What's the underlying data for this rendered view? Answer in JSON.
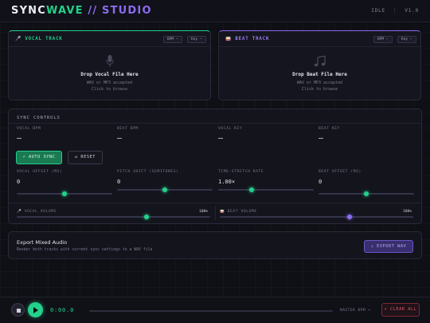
{
  "header": {
    "logo_part1": "SYNC",
    "logo_part2": "WAVE",
    "logo_part3": " // STUDIO",
    "status": "IDLE",
    "version": "V1.0"
  },
  "tracks": {
    "vocal": {
      "icon": "microphone-icon",
      "title": "VOCAL TRACK",
      "bpm_pill": "BPM —",
      "key_pill": "Key —",
      "drop_title": "Drop Vocal File Here",
      "drop_formats": "WAV or MP3 accepted",
      "drop_browse": "Click to browse"
    },
    "beat": {
      "icon": "drum-icon",
      "title": "BEAT TRACK",
      "bpm_pill": "BPM —",
      "key_pill": "Key —",
      "drop_title": "Drop Beat File Here",
      "drop_formats": "WAV or MP3 accepted",
      "drop_browse": "Click to browse"
    }
  },
  "sync": {
    "title": "SYNC CONTROLS",
    "stats": [
      {
        "label": "VOCAL BPM",
        "value": "—"
      },
      {
        "label": "BEAT BPM",
        "value": "—"
      },
      {
        "label": "VOCAL KEY",
        "value": "—"
      },
      {
        "label": "BEAT KEY",
        "value": "—"
      }
    ],
    "auto_sync_label": "⚡ AUTO SYNC",
    "reset_label": "↺ RESET",
    "controls": [
      {
        "label": "VOCAL OFFSET (MS)",
        "value": "0",
        "fraction": 0.5,
        "color": "#23d18b"
      },
      {
        "label": "PITCH SHIFT (SEMITONES)",
        "value": "0",
        "fraction": 0.5,
        "color": "#23d18b"
      },
      {
        "label": "TIME-STRETCH RATE",
        "value": "1.00×",
        "fraction": 0.35,
        "color": "#23d18b"
      },
      {
        "label": "BEAT OFFSET (MS)",
        "value": "0",
        "fraction": 0.5,
        "color": "#23d18b"
      }
    ],
    "vocal_volume": {
      "label": "VOCAL VOLUME",
      "value": "100%",
      "fraction": 0.67
    },
    "beat_volume": {
      "label": "BEAT VOLUME",
      "value": "100%",
      "fraction": 0.67
    }
  },
  "export": {
    "title": "Export Mixed Audio",
    "subtitle": "Render both tracks with current sync settings to a WAV file",
    "button_label": "↓ EXPORT WAV"
  },
  "transport": {
    "time": "0:00.0",
    "progress": 0,
    "master_label": "MASTER BPM",
    "master_value": "—",
    "clear_label": "✕ CLEAR ALL"
  },
  "colors": {
    "accent_green": "#23d18b",
    "accent_purple": "#8b6cf0",
    "danger": "#e05666"
  }
}
